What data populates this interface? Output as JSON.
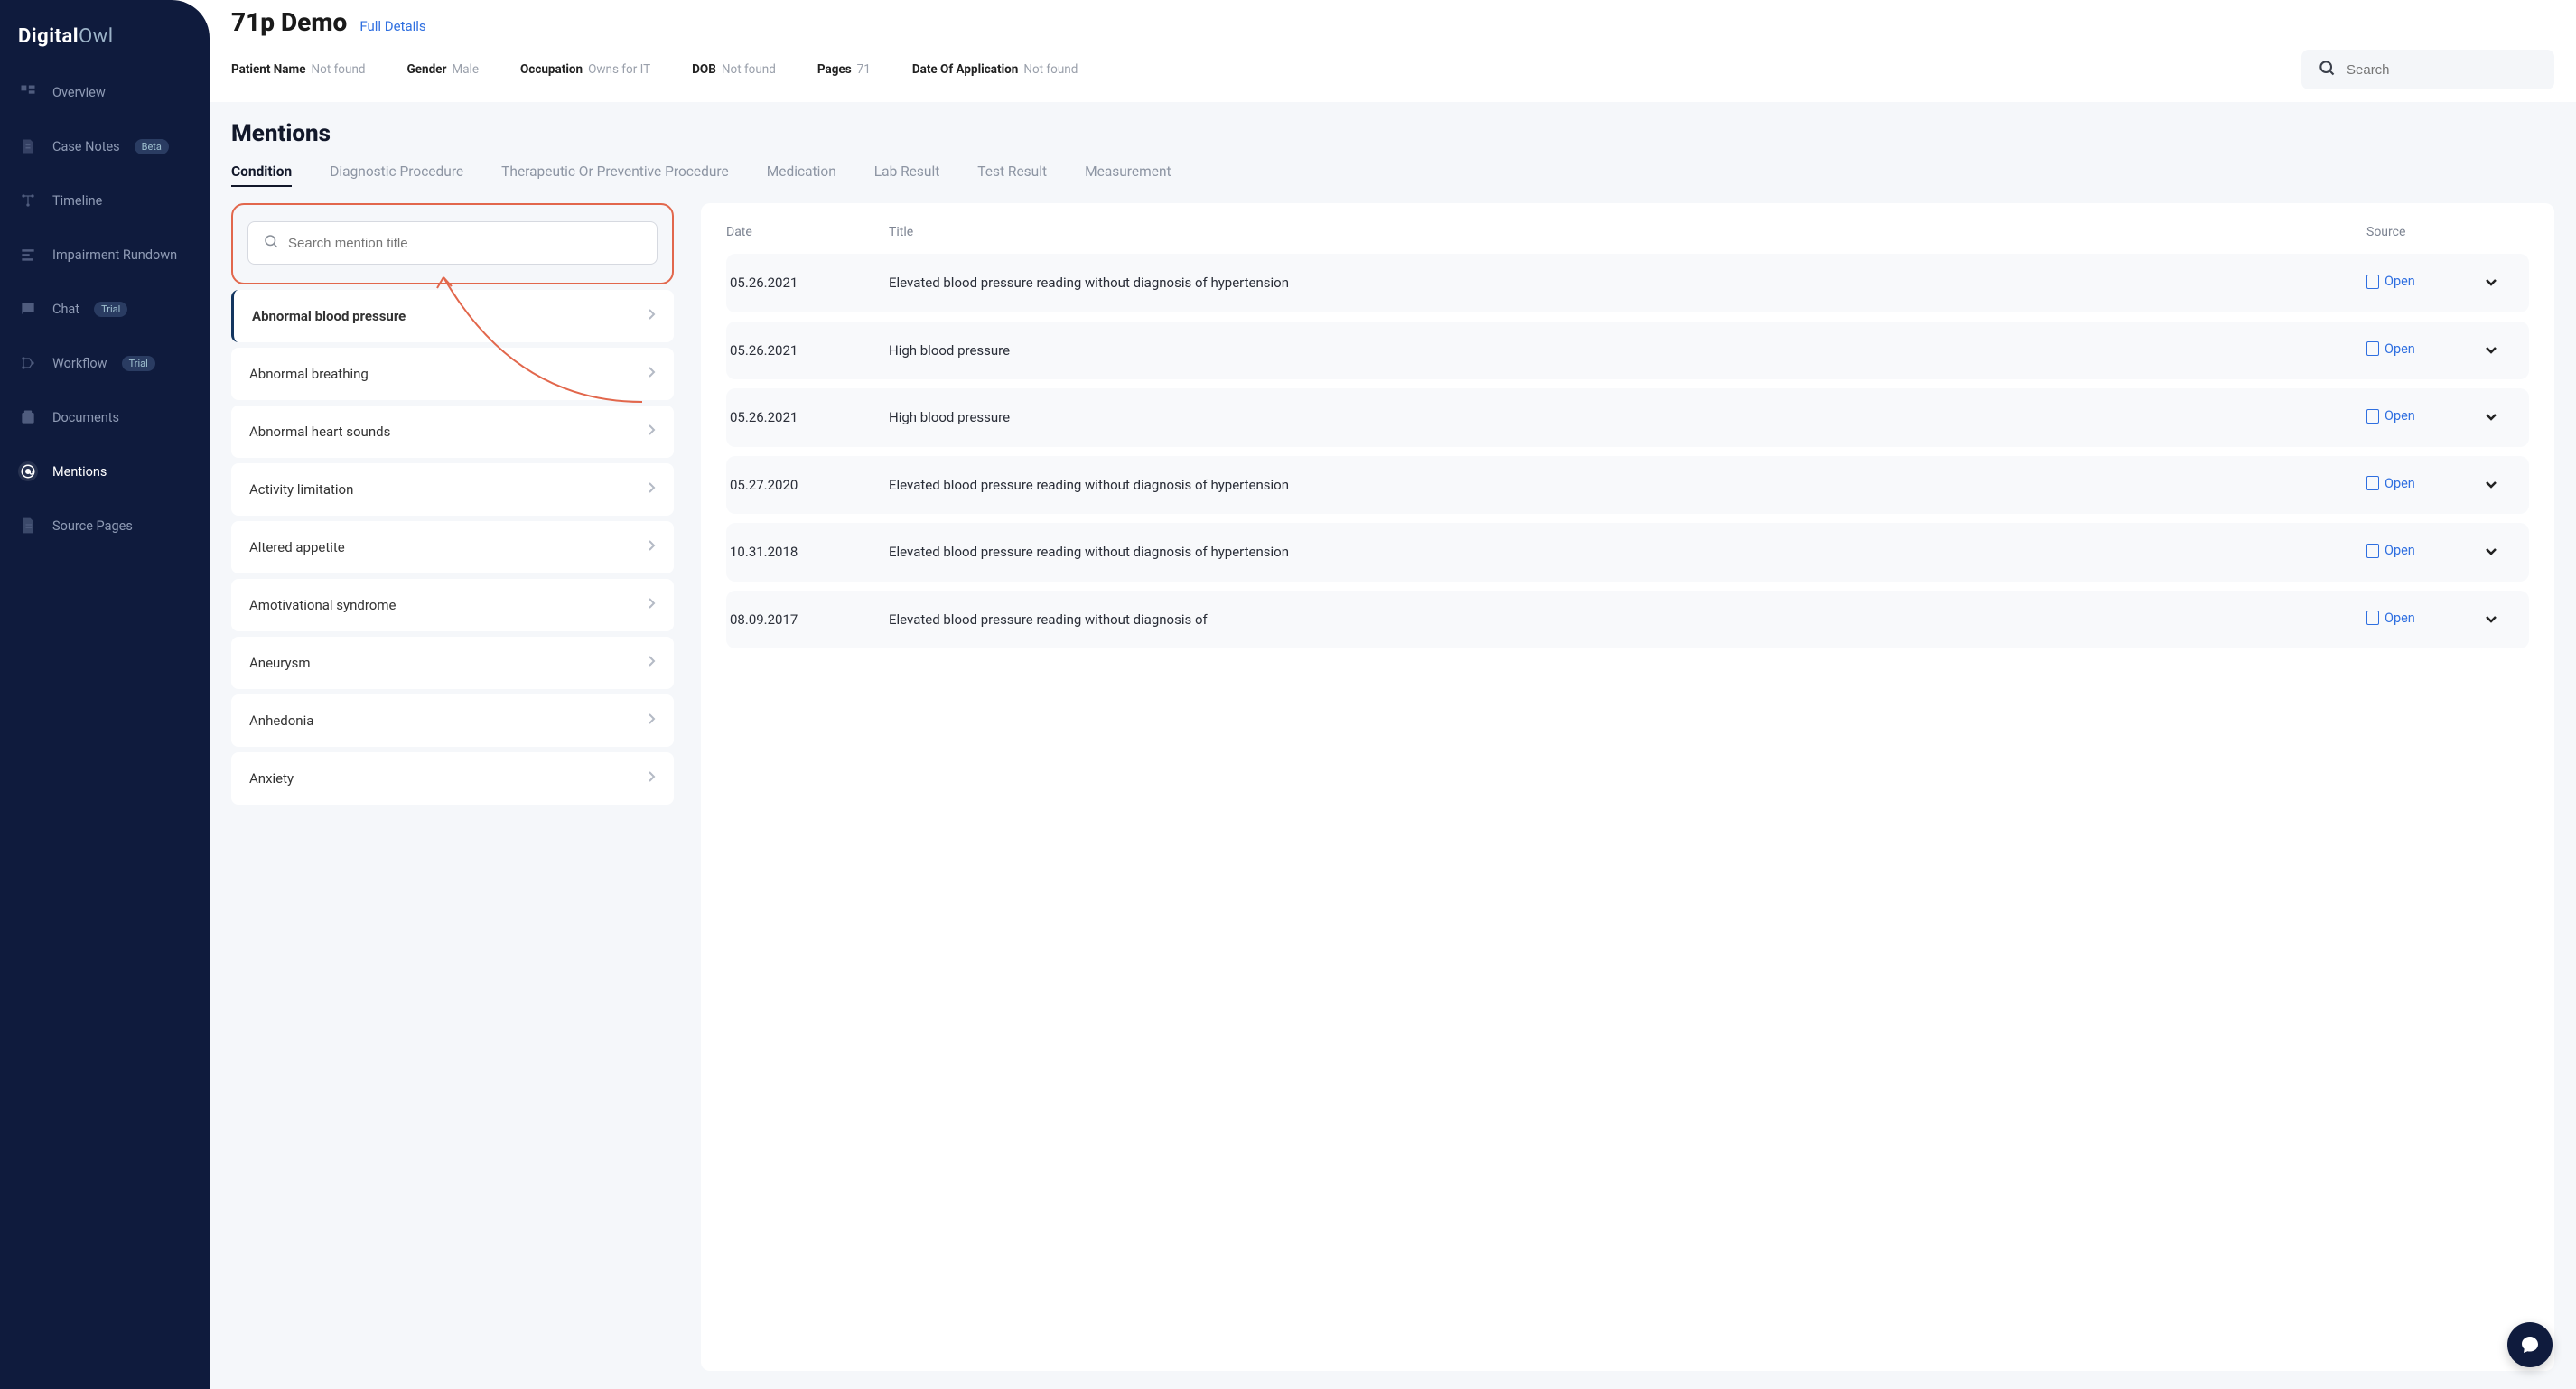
{
  "logo": {
    "part1": "Digital",
    "part2": "Owl"
  },
  "sidebar": {
    "items": [
      {
        "label": "Overview",
        "name": "overview",
        "badge": null
      },
      {
        "label": "Case Notes",
        "name": "case-notes",
        "badge": "Beta"
      },
      {
        "label": "Timeline",
        "name": "timeline",
        "badge": null
      },
      {
        "label": "Impairment Rundown",
        "name": "impairment-rundown",
        "badge": null
      },
      {
        "label": "Chat",
        "name": "chat",
        "badge": "Trial"
      },
      {
        "label": "Workflow",
        "name": "workflow",
        "badge": "Trial"
      },
      {
        "label": "Documents",
        "name": "documents",
        "badge": null
      },
      {
        "label": "Mentions",
        "name": "mentions",
        "badge": null
      },
      {
        "label": "Source Pages",
        "name": "source-pages",
        "badge": null
      }
    ],
    "active": "mentions"
  },
  "header": {
    "title": "71p Demo",
    "full_details": "Full Details",
    "meta": [
      {
        "label": "Patient Name",
        "value": "Not found"
      },
      {
        "label": "Gender",
        "value": "Male"
      },
      {
        "label": "Occupation",
        "value": "Owns for IT"
      },
      {
        "label": "DOB",
        "value": "Not found"
      },
      {
        "label": "Pages",
        "value": "71"
      },
      {
        "label": "Date Of Application",
        "value": "Not found"
      }
    ],
    "search_placeholder": "Search"
  },
  "section": {
    "title": "Mentions",
    "tabs": [
      "Condition",
      "Diagnostic Procedure",
      "Therapeutic Or Preventive Procedure",
      "Medication",
      "Lab Result",
      "Test Result",
      "Measurement"
    ],
    "active_tab": 0,
    "search_placeholder": "Search mention title"
  },
  "mentions": [
    {
      "title": "Abnormal blood pressure",
      "selected": true
    },
    {
      "title": "Abnormal breathing",
      "selected": false
    },
    {
      "title": "Abnormal heart sounds",
      "selected": false
    },
    {
      "title": "Activity limitation",
      "selected": false
    },
    {
      "title": "Altered appetite",
      "selected": false
    },
    {
      "title": "Amotivational syndrome",
      "selected": false
    },
    {
      "title": "Aneurysm",
      "selected": false
    },
    {
      "title": "Anhedonia",
      "selected": false
    },
    {
      "title": "Anxiety",
      "selected": false
    }
  ],
  "table": {
    "columns": {
      "date": "Date",
      "title": "Title",
      "source": "Source"
    },
    "open_label": "Open",
    "rows": [
      {
        "date": "05.26.2021",
        "title": "Elevated blood pressure reading without diagnosis of hypertension"
      },
      {
        "date": "05.26.2021",
        "title": "High blood pressure"
      },
      {
        "date": "05.26.2021",
        "title": "High blood pressure"
      },
      {
        "date": "05.27.2020",
        "title": "Elevated blood pressure reading without diagnosis of hypertension"
      },
      {
        "date": "10.31.2018",
        "title": "Elevated blood pressure reading without diagnosis of hypertension"
      },
      {
        "date": "08.09.2017",
        "title": "Elevated blood pressure reading without diagnosis of"
      }
    ]
  }
}
